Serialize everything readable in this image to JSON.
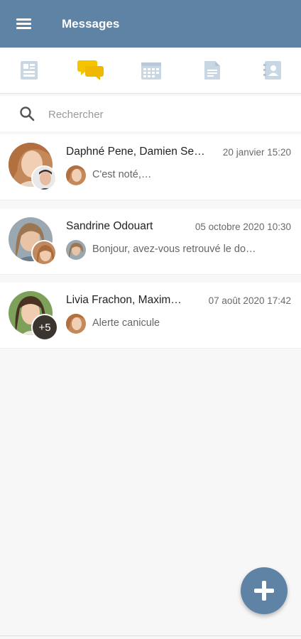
{
  "header": {
    "title": "Messages",
    "menu_icon": "hamburger-menu-icon"
  },
  "tabs": [
    {
      "name": "dashboard",
      "icon": "dashboard-icon",
      "active": false
    },
    {
      "name": "messages",
      "icon": "chat-bubbles-icon",
      "active": true
    },
    {
      "name": "calendar",
      "icon": "calendar-icon",
      "active": false
    },
    {
      "name": "documents",
      "icon": "document-icon",
      "active": false
    },
    {
      "name": "contacts",
      "icon": "contact-book-icon",
      "active": false
    }
  ],
  "search": {
    "placeholder": "Rechercher",
    "value": ""
  },
  "conversations": [
    {
      "name": "Daphné Pene, Damien Se…",
      "date": "20 janvier 15:20",
      "preview": "C'est noté,…",
      "extra_participants": ""
    },
    {
      "name": "Sandrine Odouart",
      "date": "05 octobre 2020 10:30",
      "preview": "Bonjour, avez-vous retrouvé le do…",
      "extra_participants": ""
    },
    {
      "name": "Livia Frachon, Maxim…",
      "date": "07 août 2020 17:42",
      "preview": "Alerte canicule",
      "extra_participants": "+5"
    }
  ],
  "fab": {
    "icon": "plus-icon"
  },
  "colors": {
    "primary": "#5f83a5",
    "active_tab": "#f5c400",
    "inactive_tab": "#c9d6e3",
    "background": "#f7f7f7"
  }
}
